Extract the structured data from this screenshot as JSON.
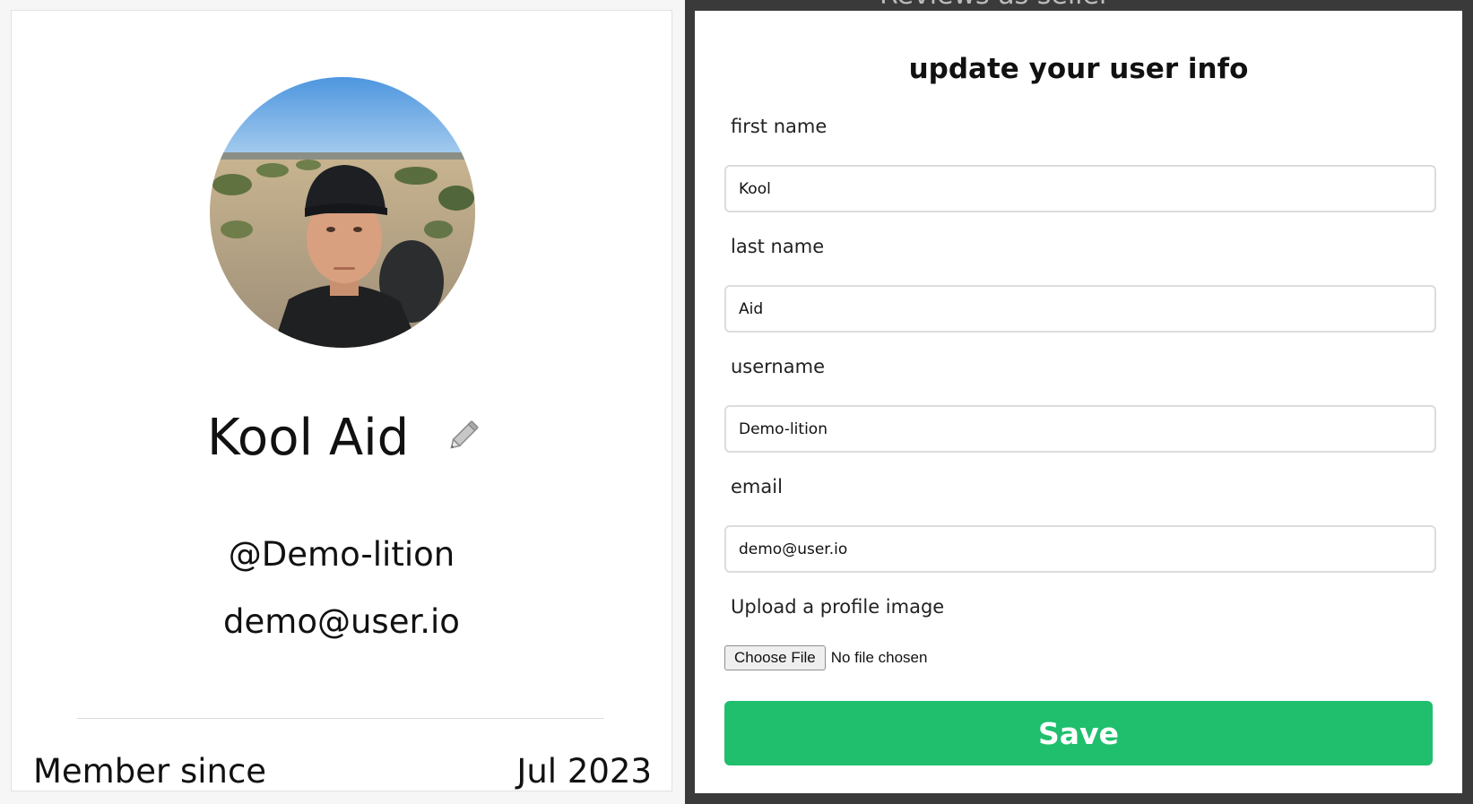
{
  "profile": {
    "full_name": "Kool Aid",
    "handle": "@Demo-lition",
    "email": "demo@user.io",
    "member_since_label": "Member since",
    "member_since_value": "Jul 2023",
    "edit_icon": "pencil-icon"
  },
  "background": {
    "partial_text": "Reviews as seller"
  },
  "modal": {
    "title": "update your user info",
    "fields": {
      "first_name": {
        "label": "first name",
        "value": "Kool"
      },
      "last_name": {
        "label": "last name",
        "value": "Aid"
      },
      "username": {
        "label": "username",
        "value": "Demo-lition"
      },
      "email": {
        "label": "email",
        "value": "demo@user.io"
      }
    },
    "upload": {
      "label": "Upload a profile image",
      "button_label": "Choose File",
      "status": "No file chosen"
    },
    "save_label": "Save"
  },
  "colors": {
    "save_button": "#1fbf6e",
    "backdrop": "#3a3a3a",
    "input_border": "#dcdcdc"
  }
}
